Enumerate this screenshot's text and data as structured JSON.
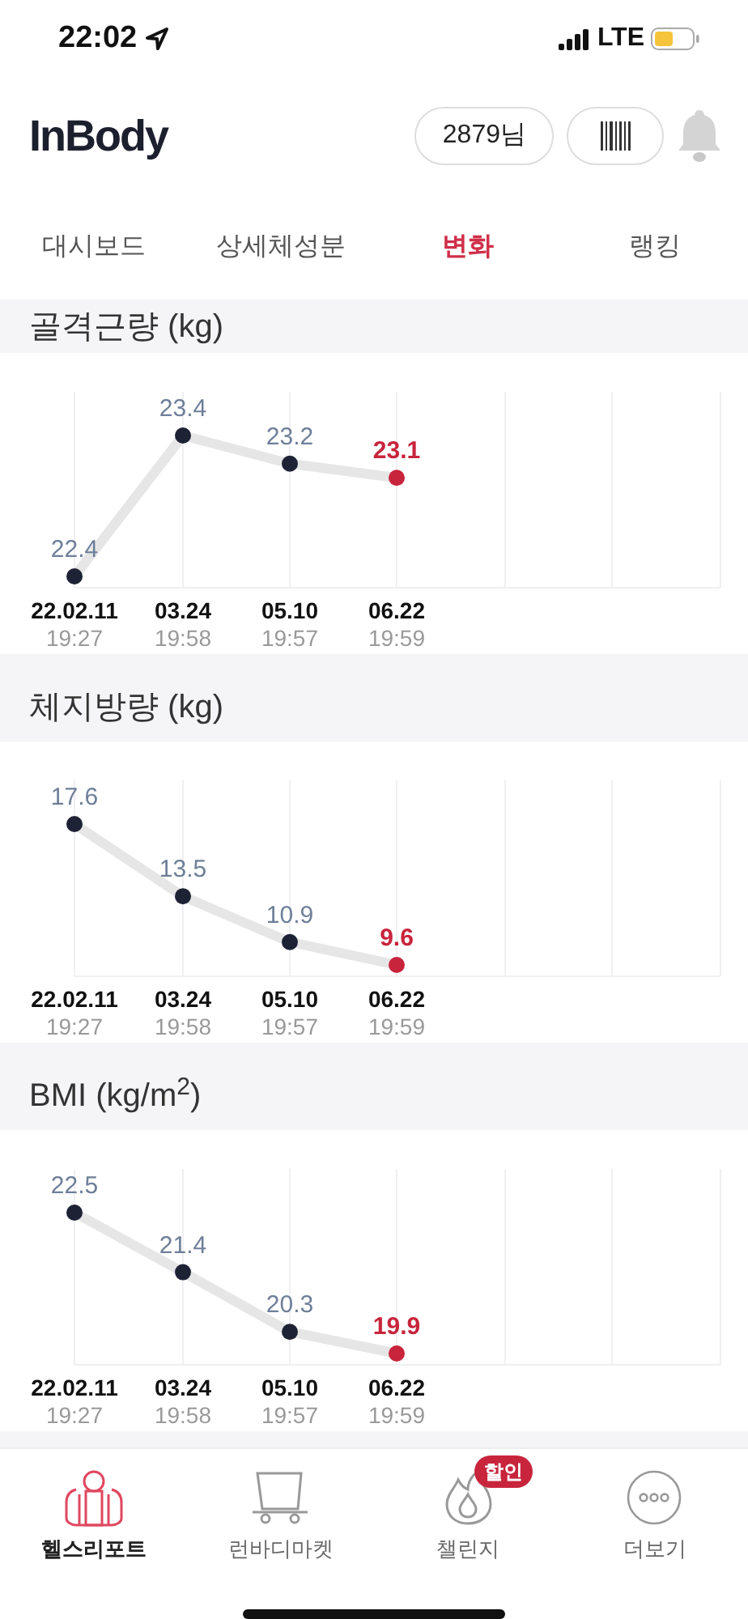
{
  "status_bar": {
    "time": "22:02",
    "network": "LTE"
  },
  "header": {
    "logo": "InBody",
    "user_button": "2879님"
  },
  "tabs": [
    {
      "label": "대시보드",
      "selected": false
    },
    {
      "label": "상세체성분",
      "selected": false
    },
    {
      "label": "변화",
      "selected": true
    },
    {
      "label": "랭킹",
      "selected": false
    }
  ],
  "sections": [
    {
      "title": "골격근량 (kg)",
      "times": [
        "19:27",
        "19:58",
        "19:57",
        "19:59"
      ],
      "chart_data": {
        "type": "line",
        "categories": [
          "22.02.11",
          "03.24",
          "05.10",
          "06.22"
        ],
        "values": [
          22.4,
          23.4,
          23.2,
          23.1
        ],
        "data_labels": true,
        "grid": true,
        "marker": true
      }
    },
    {
      "title": "체지방량 (kg)",
      "times": [
        "19:27",
        "19:58",
        "19:57",
        "19:59"
      ],
      "chart_data": {
        "type": "line",
        "categories": [
          "22.02.11",
          "03.24",
          "05.10",
          "06.22"
        ],
        "values": [
          17.6,
          13.5,
          10.9,
          9.6
        ],
        "data_labels": true,
        "grid": true,
        "marker": true
      }
    },
    {
      "title": "BMI (kg/m$^{2}$)",
      "times": [
        "19:27",
        "19:58",
        "19:57",
        "19:59"
      ],
      "chart_data": {
        "type": "line",
        "categories": [
          "22.02.11",
          "03.24",
          "05.10",
          "06.22"
        ],
        "values": [
          22.5,
          21.4,
          20.3,
          19.9
        ],
        "data_labels": true,
        "grid": true,
        "marker": true
      }
    }
  ],
  "bottom_nav": [
    {
      "label": "헬스리포트",
      "kind": "report",
      "selected": true
    },
    {
      "label": "런바디마켓",
      "kind": "cart",
      "selected": false
    },
    {
      "label": "챌린지",
      "kind": "flame",
      "selected": false,
      "badge": "할인"
    },
    {
      "label": "더보기",
      "kind": "more",
      "selected": false
    }
  ]
}
